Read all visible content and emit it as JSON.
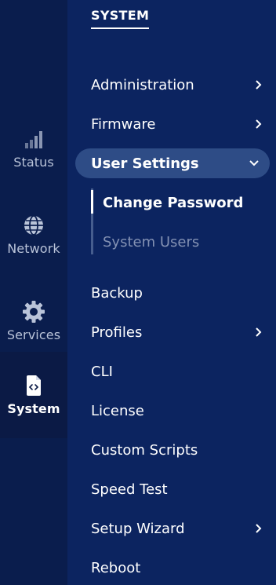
{
  "rail": {
    "items": [
      {
        "label": "Status",
        "icon": "signal-bars-icon",
        "active": false
      },
      {
        "label": "Network",
        "icon": "globe-icon",
        "active": false
      },
      {
        "label": "Services",
        "icon": "gear-icon",
        "active": false
      },
      {
        "label": "System",
        "icon": "code-file-icon",
        "active": true
      }
    ]
  },
  "panel": {
    "title": "SYSTEM",
    "menu": [
      {
        "label": "Administration",
        "has_submenu": true
      },
      {
        "label": "Firmware",
        "has_submenu": true
      },
      {
        "label": "User Settings",
        "has_submenu": true,
        "expanded": true
      },
      {
        "label": "Backup",
        "has_submenu": false
      },
      {
        "label": "Profiles",
        "has_submenu": true
      },
      {
        "label": "CLI",
        "has_submenu": false
      },
      {
        "label": "License",
        "has_submenu": false
      },
      {
        "label": "Custom Scripts",
        "has_submenu": false
      },
      {
        "label": "Speed Test",
        "has_submenu": false
      },
      {
        "label": "Setup Wizard",
        "has_submenu": true
      },
      {
        "label": "Reboot",
        "has_submenu": false
      }
    ],
    "user_settings_submenu": [
      {
        "label": "Change Password",
        "active": true
      },
      {
        "label": "System Users",
        "active": false
      }
    ]
  },
  "colors": {
    "rail_bg": "#0a1d4d",
    "panel_bg": "#0c2460",
    "expanded_bg": "#2e4c86",
    "inactive_text": "#8391b3",
    "rail_text": "#b9c3d8"
  }
}
